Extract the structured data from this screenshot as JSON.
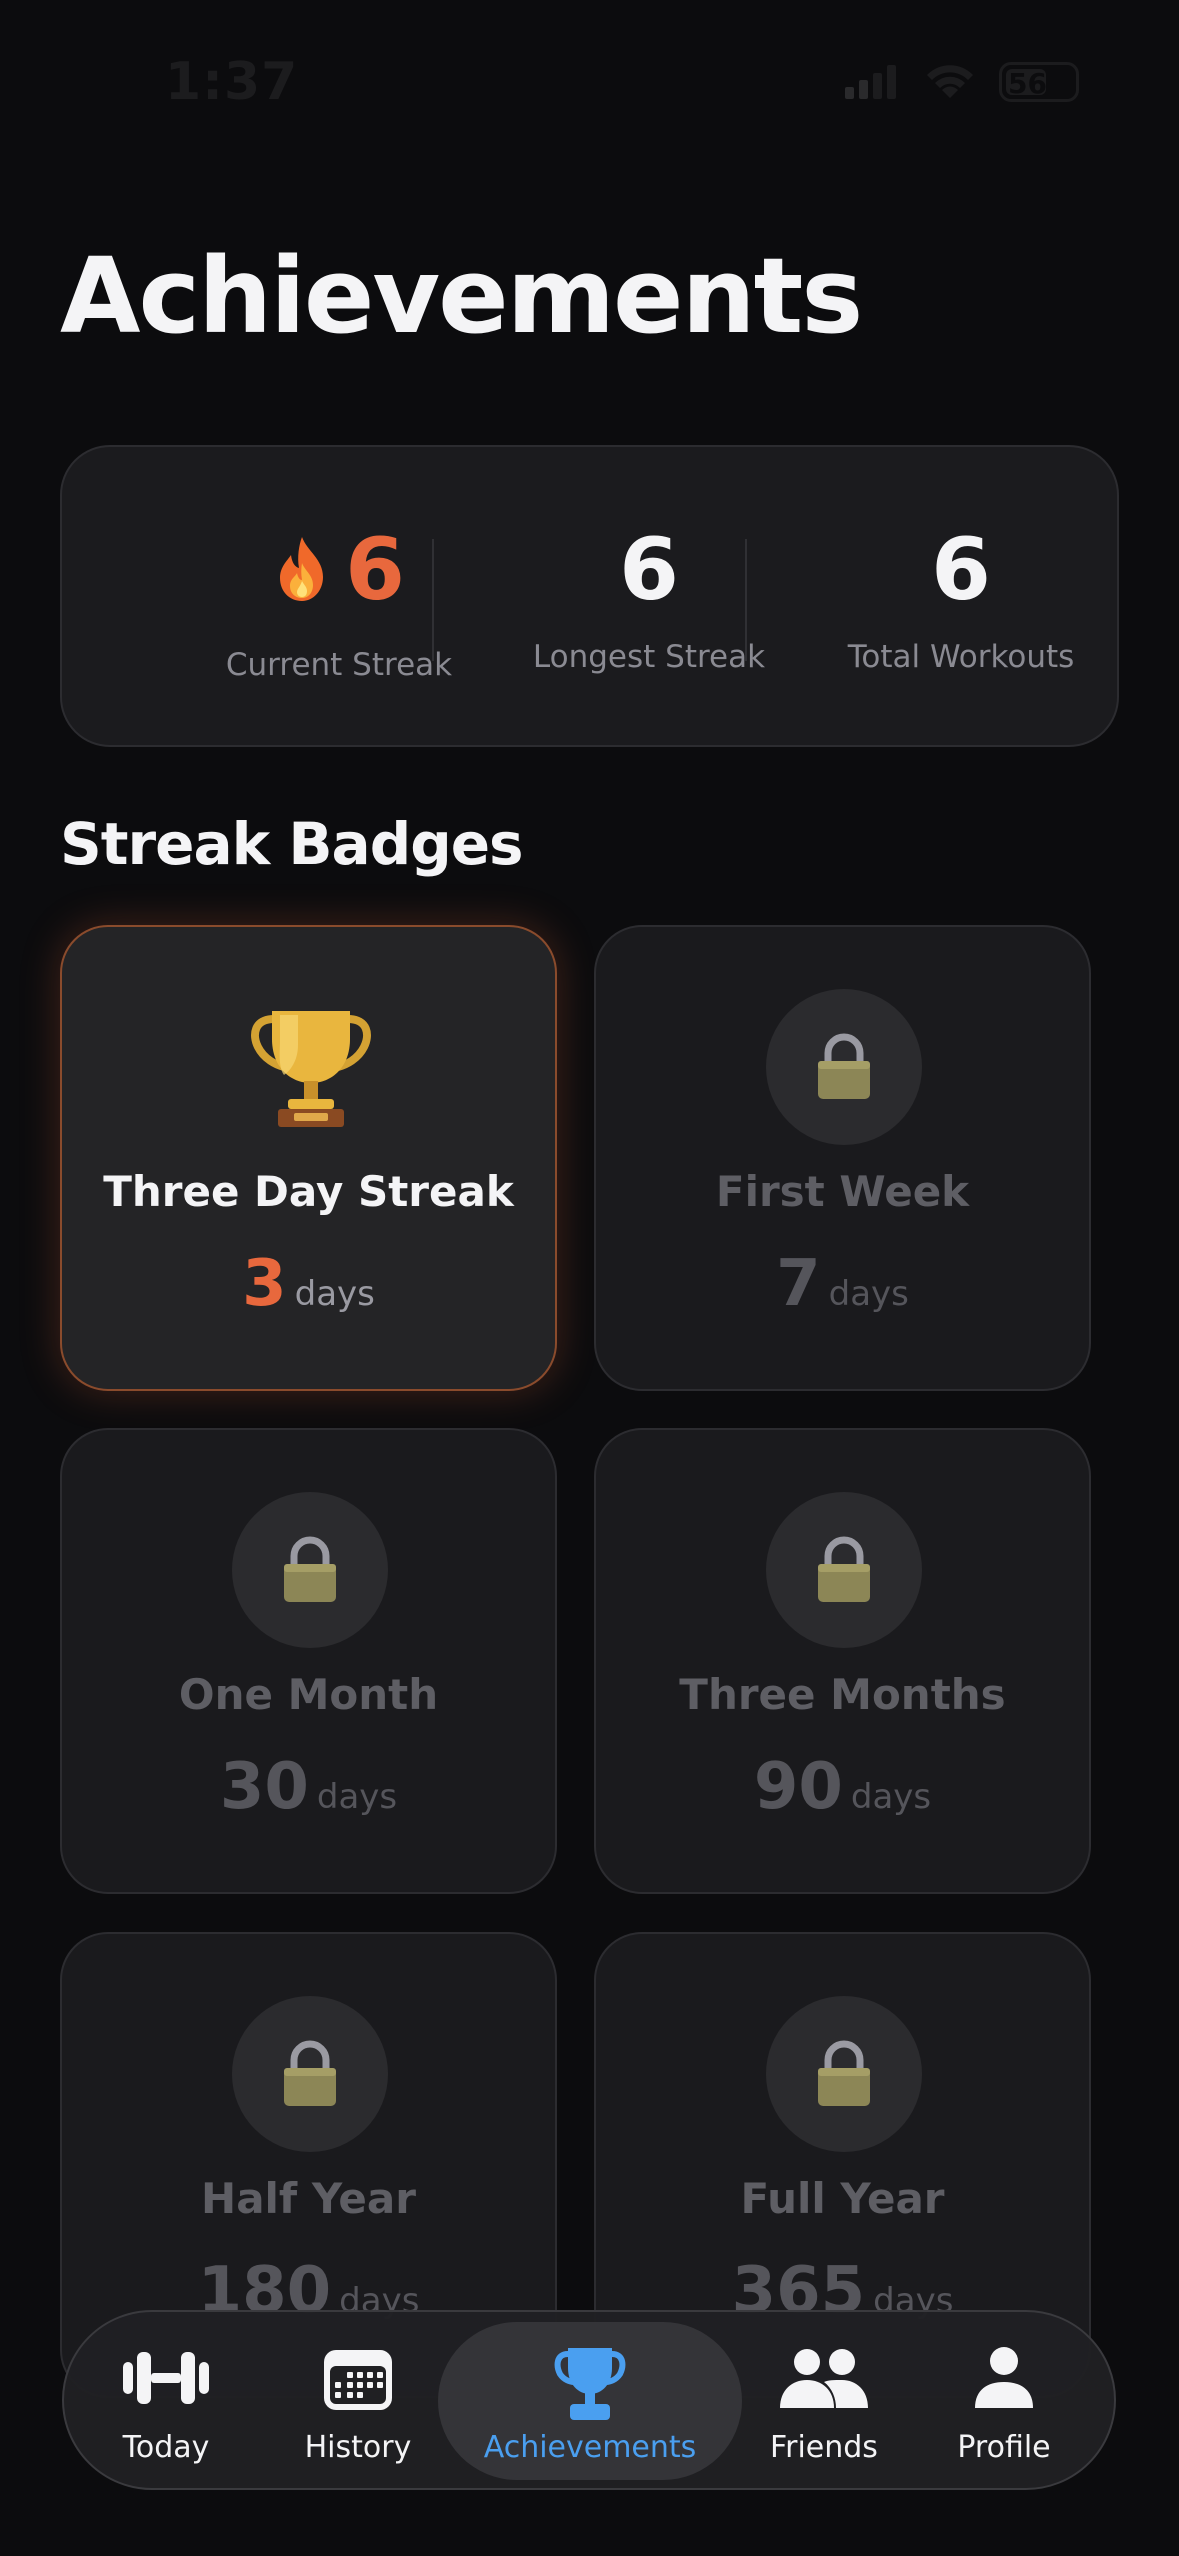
{
  "status_bar": {
    "time": "1:37",
    "battery": "56"
  },
  "page": {
    "title": "Achievements"
  },
  "stats": [
    {
      "value": "6",
      "label": "Current Streak",
      "icon": "flame-icon",
      "accent": "#e8683d"
    },
    {
      "value": "6",
      "label": "Longest Streak"
    },
    {
      "value": "6",
      "label": "Total Workouts"
    }
  ],
  "section": {
    "title": "Streak Badges"
  },
  "badges": [
    {
      "name": "Three Day Streak",
      "days": "3",
      "unit": "days",
      "unlocked": true,
      "icon": "trophy-icon"
    },
    {
      "name": "First Week",
      "days": "7",
      "unit": "days",
      "unlocked": false,
      "icon": "lock-icon"
    },
    {
      "name": "One Month",
      "days": "30",
      "unit": "days",
      "unlocked": false,
      "icon": "lock-icon"
    },
    {
      "name": "Three Months",
      "days": "90",
      "unit": "days",
      "unlocked": false,
      "icon": "lock-icon"
    },
    {
      "name": "Half Year",
      "days": "180",
      "unit": "days",
      "unlocked": false,
      "icon": "lock-icon"
    },
    {
      "name": "Full Year",
      "days": "365",
      "unit": "days",
      "unlocked": false,
      "icon": "lock-icon"
    }
  ],
  "tab_bar": {
    "active": "Achievements",
    "active_color": "#4a9ff0",
    "tabs": [
      {
        "label": "Today",
        "icon": "dumbbell-icon"
      },
      {
        "label": "History",
        "icon": "calendar-icon"
      },
      {
        "label": "Achievements",
        "icon": "trophy-icon"
      },
      {
        "label": "Friends",
        "icon": "people-icon"
      },
      {
        "label": "Profile",
        "icon": "person-icon"
      }
    ]
  }
}
